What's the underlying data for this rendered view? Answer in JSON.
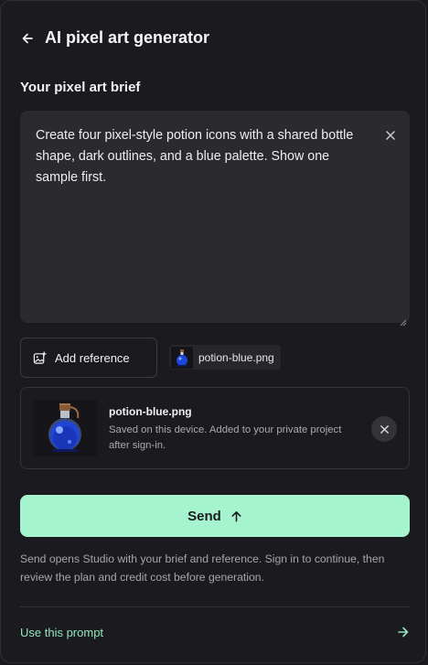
{
  "header": {
    "title": "AI pixel art generator",
    "back_icon": "arrow-left-icon"
  },
  "brief": {
    "label": "Your pixel art brief",
    "text": "Create four pixel-style potion icons with a shared bottle shape, dark outlines, and a blue palette. Show one sample first."
  },
  "reference": {
    "add_label": "Add reference",
    "chip_filename": "potion-blue.png"
  },
  "attachment": {
    "filename": "potion-blue.png",
    "description": "Saved on this device. Added to your private project after sign-in."
  },
  "send": {
    "label": "Send"
  },
  "note": "Send opens Studio with your brief and reference. Sign in to continue, then review the plan and credit cost before generation.",
  "footer": {
    "use_prompt_label": "Use this prompt"
  },
  "colors": {
    "accent": "#a6f4cf",
    "link": "#8ee6bd",
    "background": "#1b1b1f"
  }
}
